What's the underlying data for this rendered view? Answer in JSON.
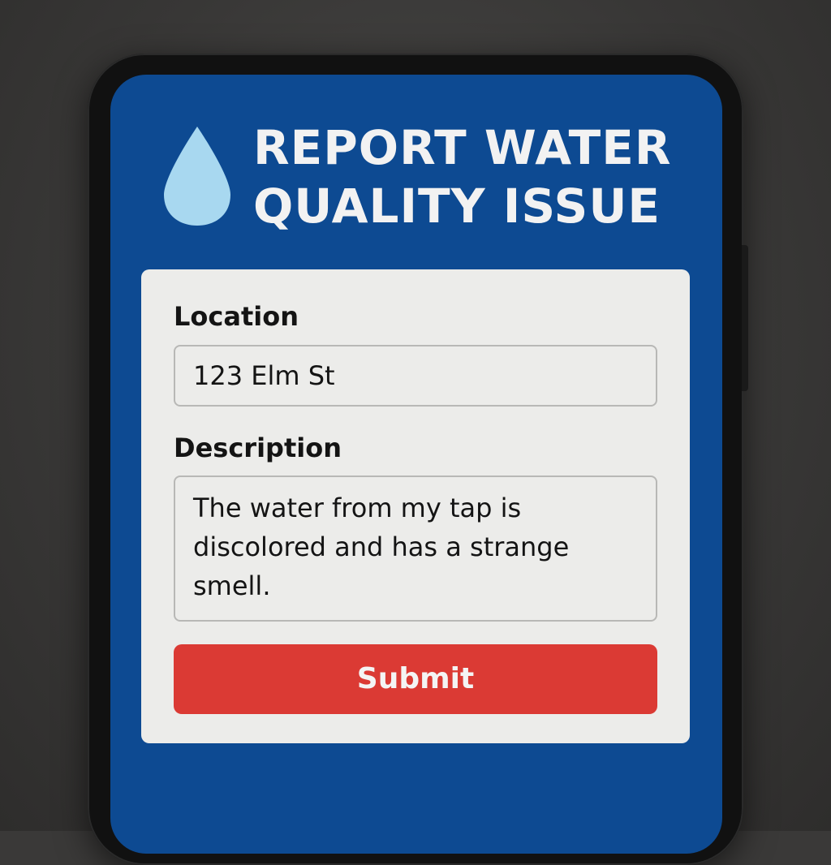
{
  "header": {
    "title": "REPORT WATER QUALITY ISSUE",
    "icon": "water-drop-icon"
  },
  "form": {
    "location": {
      "label": "Location",
      "value": "123 Elm St"
    },
    "description": {
      "label": "Description",
      "value": "The water from my tap is discolored and has a strange smell."
    },
    "submit_label": "Submit"
  },
  "colors": {
    "screen_background": "#0d4a92",
    "card_background": "#ececea",
    "submit_button": "#db3a34",
    "drop_icon": "#a8d8f0",
    "title_text": "#f2f2f2"
  }
}
